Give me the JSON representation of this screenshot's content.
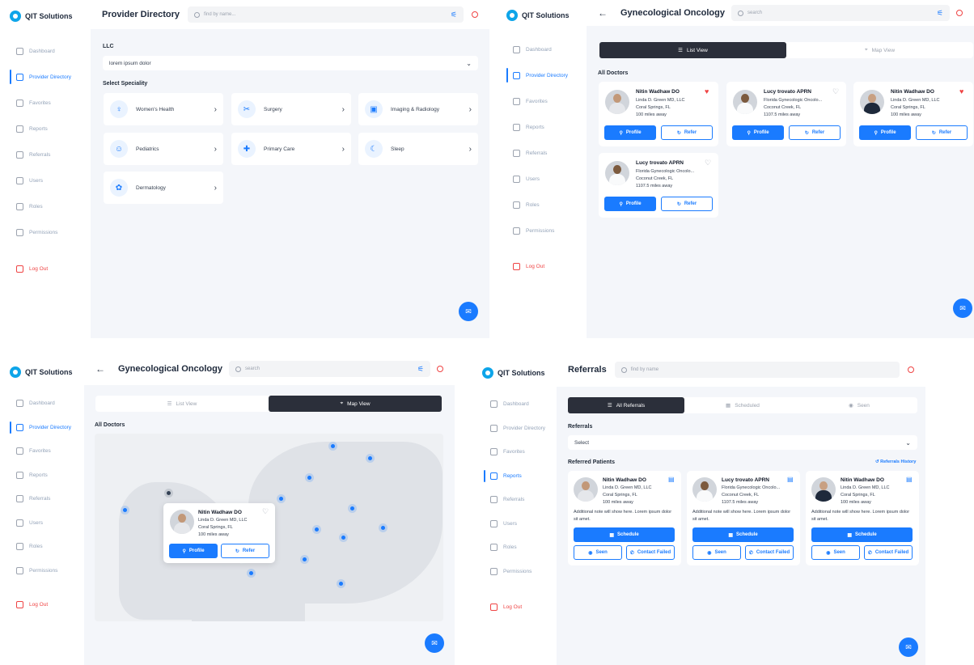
{
  "app": {
    "brand": "QIT Solutions"
  },
  "nav": [
    "Dashboard",
    "Provider Directory",
    "Favorites",
    "Reports",
    "Referrals",
    "Users",
    "Roles",
    "Permissions"
  ],
  "logout": "Log Out",
  "directory": {
    "title": "Provider Directory",
    "search_placeholder": "find by name...",
    "llc_label": "LLC",
    "llc_value": "lorem ipsum dolor",
    "speciality_label": "Select Speciality",
    "specialities": [
      {
        "name": "Women's Health",
        "icon": "womens-health-icon"
      },
      {
        "name": "Surgery",
        "icon": "surgery-icon"
      },
      {
        "name": "Imaging & Radiology",
        "icon": "imaging-icon"
      },
      {
        "name": "Pediatrics",
        "icon": "pediatrics-icon"
      },
      {
        "name": "Primary Care",
        "icon": "primary-care-icon"
      },
      {
        "name": "Sleep",
        "icon": "sleep-icon"
      },
      {
        "name": "Dermatology",
        "icon": "dermatology-icon"
      }
    ]
  },
  "oncology": {
    "title": "Gynecological Oncology",
    "search_placeholder": "search",
    "list_view": "List View",
    "map_view": "Map View",
    "all_doctors": "All Doctors",
    "profile": "Profile",
    "refer": "Refer"
  },
  "doctors": [
    {
      "name": "Nitin Wadhaw DO",
      "org": "Linda D. Green MD, LLC",
      "city": "Coral Springs, FL",
      "distance": "100 miles away",
      "favorite": true
    },
    {
      "name": "Lucy trovato APRN",
      "org": "Florida Gynecologic Oncolo...",
      "city": "Coconut Creek, FL",
      "distance": "1107.5 miles away",
      "favorite": false
    },
    {
      "name": "Nitin Wadhaw DO",
      "org": "Linda D. Green MD, LLC",
      "city": "Coral Springs, FL",
      "distance": "100 miles away",
      "favorite": true
    },
    {
      "name": "Lucy trovato APRN",
      "org": "Florida Gynecologic Oncolo...",
      "city": "Coconut Creek, FL",
      "distance": "1107.5 miles away",
      "favorite": false
    }
  ],
  "map_popup": {
    "name": "Nitin Wadhaw DO",
    "org": "Linda D. Green MD, LLC",
    "city": "Coral Springs, FL",
    "distance": "100 miles away"
  },
  "referrals": {
    "title": "Referrals",
    "search_placeholder": "find by name",
    "tabs": [
      "All Referrals",
      "Scheduled",
      "Seen"
    ],
    "filter_label": "Referrals",
    "filter_value": "Select",
    "section": "Referred Patients",
    "history_link": "Referrals History",
    "note": "Additional note will show here. Lorem ipsum dolor sit amet.",
    "schedule": "Schedule",
    "seen": "Seen",
    "contact_failed": "Contact Failed",
    "cards": [
      {
        "name": "Nitin Wadhaw DO",
        "org": "Linda D. Green MD, LLC",
        "city": "Coral Springs, FL",
        "distance": "100 miles away"
      },
      {
        "name": "Lucy trovato APRN",
        "org": "Florida Gynecologic Oncolo...",
        "city": "Coconut Creek, FL",
        "distance": "1107.5 miles away"
      },
      {
        "name": "Nitin Wadhaw DO",
        "org": "Linda D. Green MD, LLC",
        "city": "Coral Springs, FL",
        "distance": "100 miles away"
      }
    ]
  },
  "colors": {
    "accent": "#1a7bff",
    "dark": "#2b2f3a",
    "danger": "#ef4444",
    "bg": "#f4f6fa"
  }
}
